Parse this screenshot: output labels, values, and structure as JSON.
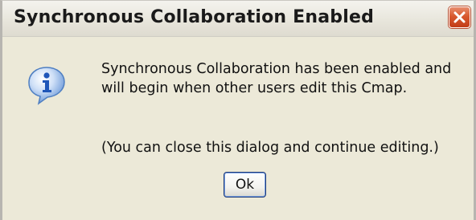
{
  "dialog": {
    "title": "Synchronous Collaboration Enabled",
    "message_line1": "Synchronous Collaboration has been enabled and",
    "message_line2": "will begin when other users edit this Cmap.",
    "note": "(You can close this dialog and continue editing.)",
    "ok_label": "Ok",
    "icon": "info-icon",
    "close_icon": "close-icon"
  },
  "colors": {
    "window_bg": "#ece9d8",
    "close_button": "#d8592f",
    "info_icon": "#2f6ec8"
  }
}
